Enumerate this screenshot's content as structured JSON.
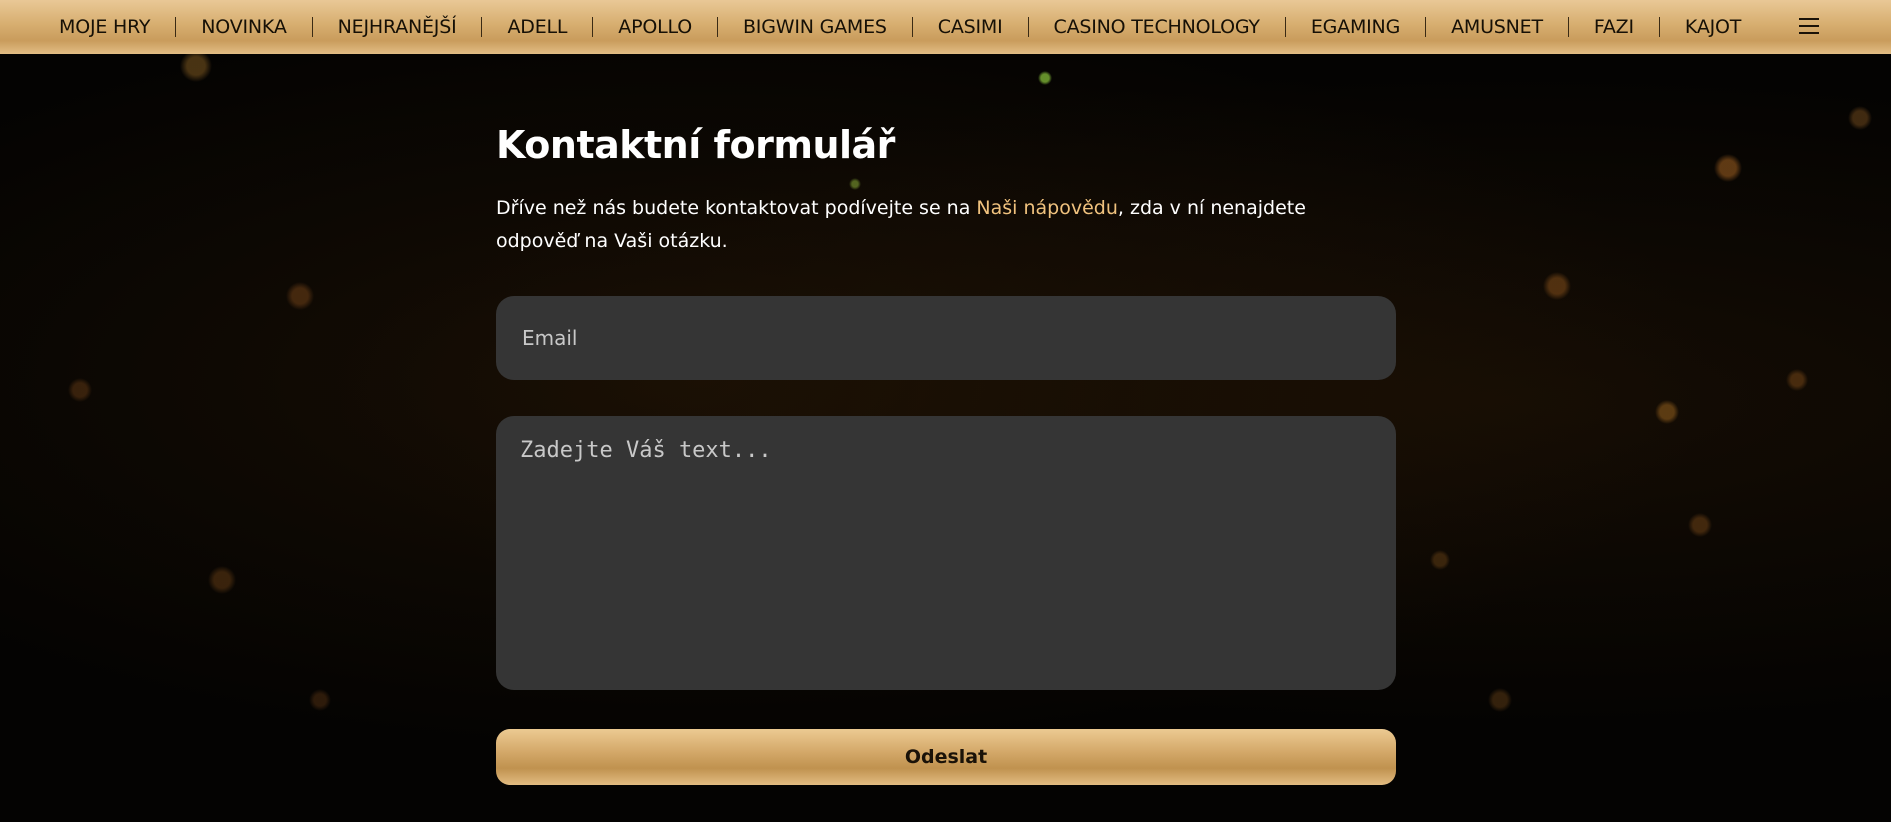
{
  "nav": {
    "items": [
      {
        "label": "MOJE HRY"
      },
      {
        "label": "NOVINKA"
      },
      {
        "label": "NEJHRANĚJŠÍ"
      },
      {
        "label": "ADELL"
      },
      {
        "label": "APOLLO"
      },
      {
        "label": "BIGWIN GAMES"
      },
      {
        "label": "CASIMI"
      },
      {
        "label": "CASINO TECHNOLOGY"
      },
      {
        "label": "EGAMING"
      },
      {
        "label": "AMUSNET"
      },
      {
        "label": "FAZI"
      },
      {
        "label": "KAJOT"
      }
    ],
    "menu_icon": "hamburger-menu-icon"
  },
  "form": {
    "title": "Kontaktní formulář",
    "intro_before": "Dříve než nás budete kontaktovat podívejte se na ",
    "intro_link": "Naši nápovědu",
    "intro_after": ", zda v ní nenajdete odpověď na Vaši otázku.",
    "email_placeholder": "Email",
    "text_placeholder": "Zadejte Váš text...",
    "submit_label": "Odeslat"
  },
  "colors": {
    "accent_gold": "#d7ae70",
    "link": "#f0c27e",
    "input_bg": "#353535",
    "background": "#040302"
  }
}
